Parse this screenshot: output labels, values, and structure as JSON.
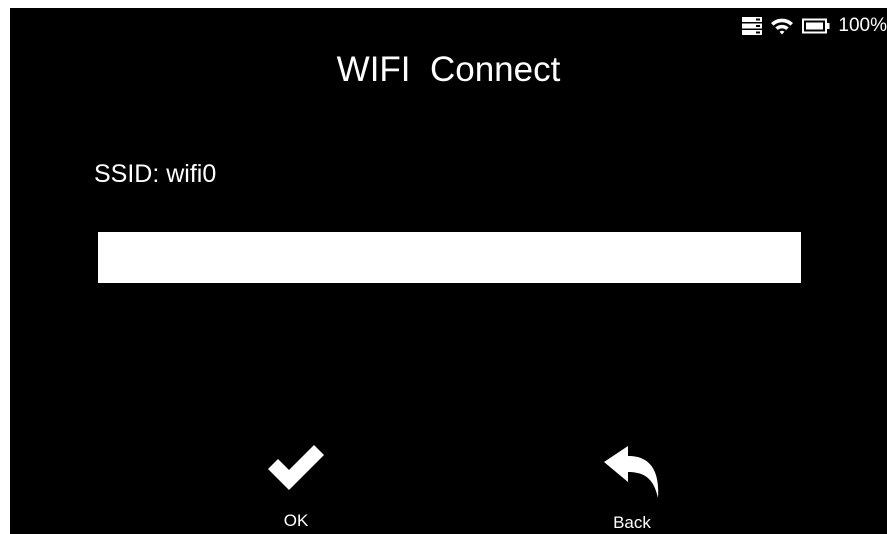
{
  "status_bar": {
    "battery_percent": "100%",
    "icons": [
      "storage-icon",
      "wifi-icon",
      "battery-icon"
    ]
  },
  "title": "WIFI  Connect",
  "ssid_label": "SSID: wifi0",
  "password_input": {
    "value": "",
    "placeholder": ""
  },
  "buttons": {
    "ok_label": "OK",
    "back_label": "Back"
  },
  "colors": {
    "background": "#000000",
    "foreground": "#ffffff"
  }
}
